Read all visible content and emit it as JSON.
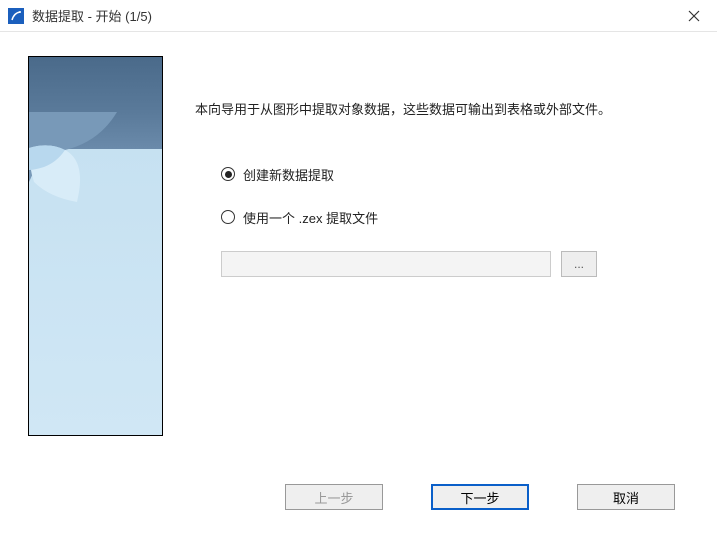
{
  "window": {
    "title": "数据提取 - 开始 (1/5)"
  },
  "intro": "本向导用于从图形中提取对象数据，这些数据可输出到表格或外部文件。",
  "options": {
    "create_new": "创建新数据提取",
    "use_existing": "使用一个 .zex 提取文件"
  },
  "file": {
    "value": "",
    "browse": "..."
  },
  "buttons": {
    "back": "上一步",
    "next": "下一步",
    "cancel": "取消"
  }
}
